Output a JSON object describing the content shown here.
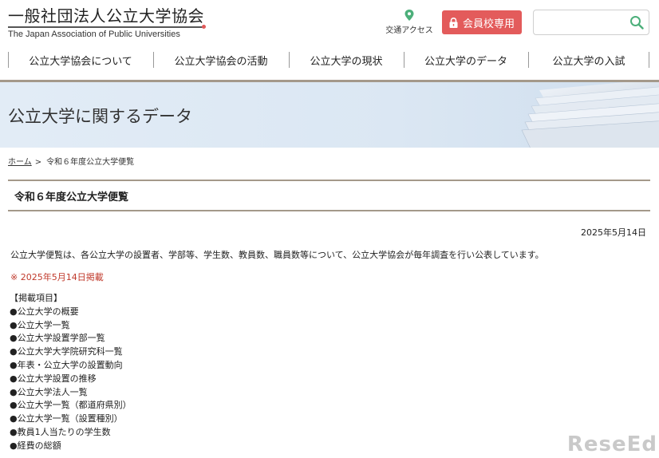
{
  "header": {
    "logo_jp": "一般社団法人公立大学協会",
    "logo_en": "The Japan Association of Public Universities",
    "access_label": "交通アクセス",
    "member_button": "会員校専用",
    "search_placeholder": ""
  },
  "nav": {
    "items": [
      {
        "label": "公立大学協会について"
      },
      {
        "label": "公立大学協会の活動"
      },
      {
        "label": "公立大学の現状"
      },
      {
        "label": "公立大学のデータ"
      },
      {
        "label": "公立大学の入試"
      }
    ]
  },
  "banner": {
    "title": "公立大学に関するデータ"
  },
  "breadcrumb": {
    "home": "ホーム",
    "separator": ">",
    "current": "令和６年度公立大学便覧"
  },
  "page": {
    "title": "令和６年度公立大学便覧",
    "date": "2025年5月14日",
    "intro": "公立大学便覧は、各公立大学の設置者、学部等、学生数、教員数、職員数等について、公立大学協会が毎年調査を行い公表しています。",
    "note": "※ 2025年5月14日掲載",
    "items_heading": "【掲載項目】",
    "items": [
      "●公立大学の概要",
      "●公立大学一覧",
      "●公立大学設置学部一覧",
      "●公立大学大学院研究科一覧",
      "●年表・公立大学の設置動向",
      "●公立大学設置の推移",
      "●公立大学法人一覧",
      "●公立大学一覧（都道府県別）",
      "●公立大学一覧（設置種別）",
      "●教員1人当たりの学生数",
      "●経費の総額"
    ]
  },
  "watermark": "ReseEd",
  "colors": {
    "accent_red": "#e35b5b",
    "rule_taupe": "#a4998a",
    "pin_green": "#4caf7a",
    "note_red": "#c0392b"
  },
  "icons": {
    "access": "map-pin-icon",
    "member": "lock-icon",
    "search": "search-icon"
  }
}
